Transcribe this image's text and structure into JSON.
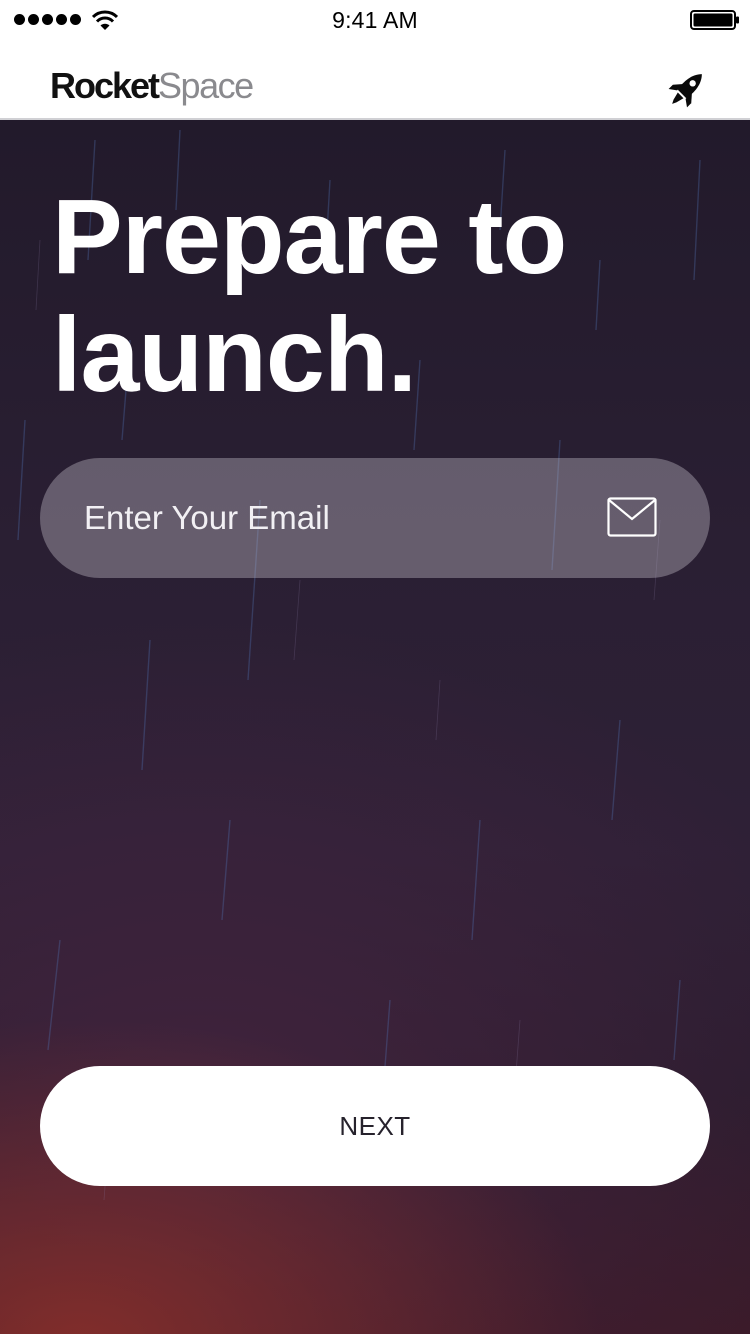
{
  "status_bar": {
    "time": "9:41 AM"
  },
  "nav": {
    "logo_primary": "Rocket",
    "logo_secondary": "Space",
    "icon": "rocket-icon"
  },
  "hero": {
    "headline": "Prepare to launch.",
    "email": {
      "placeholder": "Enter Your Email",
      "value": "",
      "icon": "envelope-icon"
    },
    "next_label": "NEXT"
  },
  "colors": {
    "background_top": "#221a2b",
    "background_bottom_glow": "#963228",
    "button_bg": "#ffffff",
    "button_text": "#26222c",
    "logo_primary": "#111111",
    "logo_secondary": "#8a8a8e"
  }
}
